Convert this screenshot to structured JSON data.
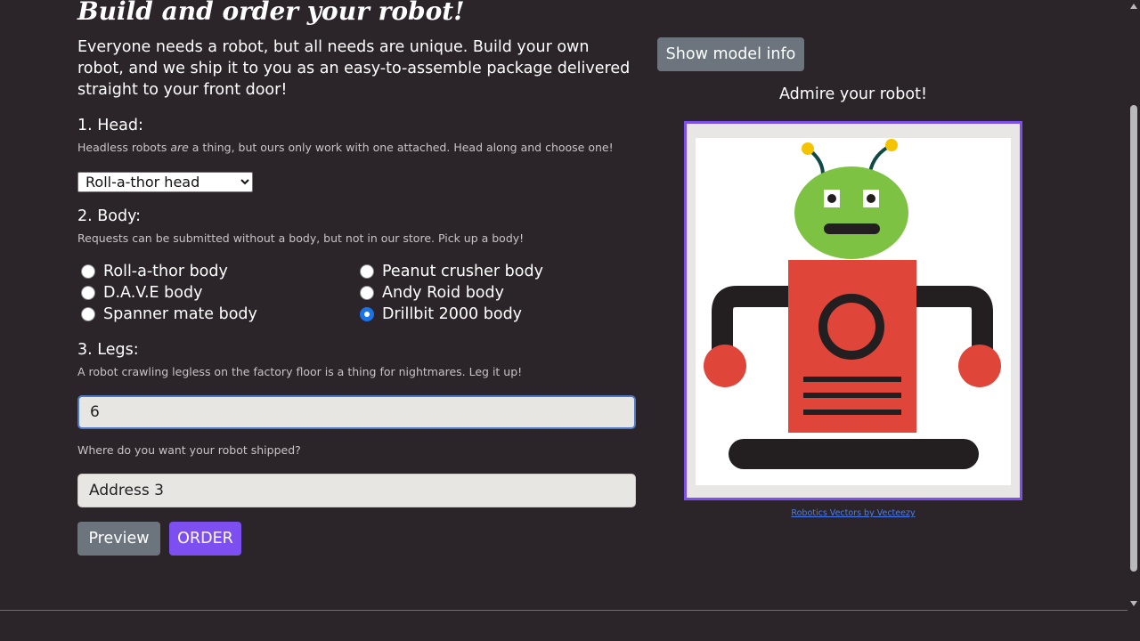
{
  "title": "Build and order your robot!",
  "intro": "Everyone needs a robot, but all needs are unique. Build your own robot, and we ship it to you as an easy-to-assemble package delivered straight to your front door!",
  "head": {
    "heading": "1. Head:",
    "hint_before": "Headless robots ",
    "hint_em": "are",
    "hint_after": " a thing, but ours only work with one attached. Head along and choose one!",
    "selected": "Roll-a-thor head"
  },
  "body": {
    "heading": "2. Body:",
    "hint": "Requests can be submitted without a body, but not in our store. Pick up a body!",
    "options": [
      {
        "label": "Roll-a-thor body",
        "checked": false
      },
      {
        "label": "Peanut crusher body",
        "checked": false
      },
      {
        "label": "D.A.V.E body",
        "checked": false
      },
      {
        "label": "Andy Roid body",
        "checked": false
      },
      {
        "label": "Spanner mate body",
        "checked": false
      },
      {
        "label": "Drillbit 2000 body",
        "checked": true
      }
    ]
  },
  "legs": {
    "heading": "3. Legs:",
    "hint": "A robot crawling legless on the factory floor is a thing for nightmares. Leg it up!",
    "value": "6"
  },
  "address": {
    "hint": "Where do you want your robot shipped?",
    "value": "Address 3"
  },
  "buttons": {
    "preview": "Preview",
    "order": "ORDER",
    "model_info": "Show model info"
  },
  "preview": {
    "caption": "Admire your robot!",
    "credit": "Robotics Vectors by Vecteezy"
  },
  "colors": {
    "accent": "#7d4ff0",
    "background": "#2b2529",
    "robot_head": "#7dc242",
    "robot_body": "#e0453a",
    "robot_dark": "#231f20",
    "antenna_tip": "#f5c400"
  }
}
